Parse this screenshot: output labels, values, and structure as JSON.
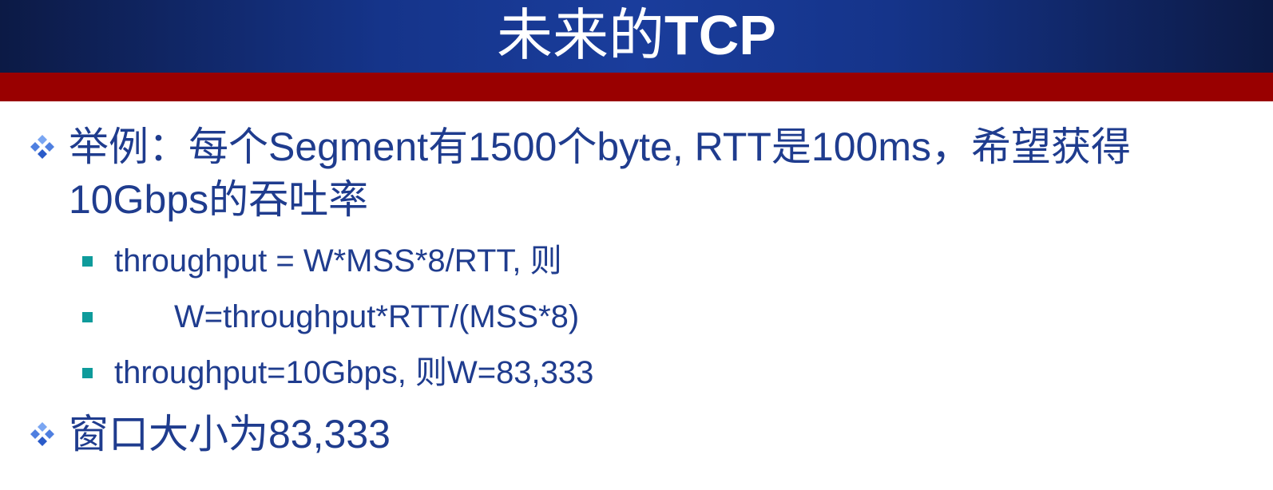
{
  "slide": {
    "title_cjk": "未来的",
    "title_latin": "TCP"
  },
  "bullets": [
    {
      "text_line1": "举例：每个Segment有1500个byte, RTT是100ms，希望获得",
      "text_line2": "10Gbps的吞吐率",
      "sub": [
        "throughput = W*MSS*8/RTT, 则",
        "W=throughput*RTT/(MSS*8)",
        "throughput=10Gbps, 则W=83,333"
      ]
    },
    {
      "text_line1": "窗口大小为83,333"
    }
  ],
  "colors": {
    "title_bg": "#15348a",
    "accent_bar": "#990000",
    "text": "#1f3c8e",
    "sub_bullet": "#0e9b9b"
  },
  "icons": {
    "level1": "diamond-bullet-icon",
    "level2": "square-bullet-icon"
  }
}
